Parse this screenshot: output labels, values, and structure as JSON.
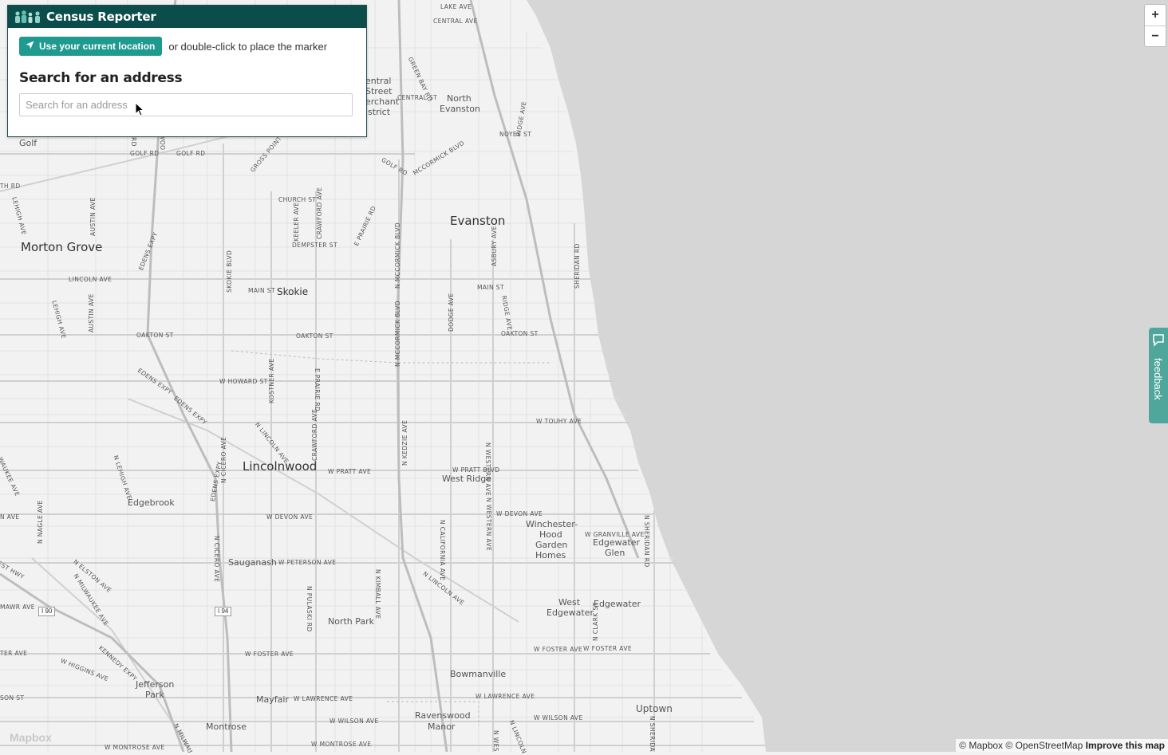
{
  "panel": {
    "title": "Census Reporter",
    "locate_button": "Use your current location",
    "hint": "or double-click to place the marker",
    "search_heading": "Search for an address",
    "search_placeholder": "Search for an address"
  },
  "zoom": {
    "in": "+",
    "out": "−"
  },
  "feedback": {
    "label": "feedback"
  },
  "mapbox_logo": "Mapbox",
  "attribution": {
    "mapbox": "© Mapbox",
    "osm": "© OpenStreetMap",
    "improve": "Improve this map"
  },
  "colors": {
    "panel_header": "#0b4d4a",
    "accent": "#1e9a8f",
    "lake": "#d6d6d6",
    "land": "#f2f2f2",
    "feedback": "#4fa79b"
  },
  "map": {
    "cities": [
      {
        "id": "evanston",
        "text": "Evanston"
      },
      {
        "id": "morton-grove",
        "text": "Morton Grove"
      },
      {
        "id": "lincolnwood",
        "text": "Lincolnwood"
      }
    ],
    "places": [
      {
        "id": "skokie",
        "text": "Skokie"
      },
      {
        "id": "golf",
        "text": "Golf"
      },
      {
        "id": "edgebrook",
        "text": "Edgebrook"
      },
      {
        "id": "sauganash",
        "text": "Sauganash"
      },
      {
        "id": "west-ridge",
        "text": "West Ridge"
      },
      {
        "id": "north-park",
        "text": "North Park"
      },
      {
        "id": "bowmanville",
        "text": "Bowmanville"
      },
      {
        "id": "uptown",
        "text": "Uptown"
      },
      {
        "id": "mayfair",
        "text": "Mayfair"
      },
      {
        "id": "montrose",
        "text": "Montrose"
      },
      {
        "id": "jefferson",
        "text": "Jefferson"
      },
      {
        "id": "jefferson-park",
        "text": "Park"
      },
      {
        "id": "ravenswood",
        "text": "Ravenswood"
      },
      {
        "id": "ravenswood-manor",
        "text": "Manor"
      },
      {
        "id": "north",
        "text": "North"
      },
      {
        "id": "north-evanston",
        "text": "Evanston"
      },
      {
        "id": "winchester",
        "text": "Winchester-"
      },
      {
        "id": "winchester-hood",
        "text": "Hood"
      },
      {
        "id": "garden",
        "text": "Garden"
      },
      {
        "id": "homes",
        "text": "Homes"
      },
      {
        "id": "edgewater",
        "text": "Edgewater"
      },
      {
        "id": "edgewater-glen",
        "text": "Glen"
      },
      {
        "id": "edgewater-2",
        "text": "Edgewater"
      },
      {
        "id": "west",
        "text": "West"
      },
      {
        "id": "west-edgewater",
        "text": "Edgewater"
      },
      {
        "id": "central",
        "text": "entral"
      },
      {
        "id": "street",
        "text": "Street"
      },
      {
        "id": "merchant",
        "text": "erchant"
      },
      {
        "id": "district",
        "text": "istrict"
      }
    ],
    "streets": [
      {
        "id": "lake-ave",
        "text": "LAKE AVE"
      },
      {
        "id": "central-ave",
        "text": "CENTRAL AVE"
      },
      {
        "id": "green-bay-rd",
        "text": "GREEN BAY RD"
      },
      {
        "id": "central-st",
        "text": "CENTRAL ST"
      },
      {
        "id": "noyes-st",
        "text": "NOYES ST"
      },
      {
        "id": "ridge-ave-n",
        "text": "RIDGE AVE"
      },
      {
        "id": "mccormick-blvd",
        "text": "MCCORMICK BLVD"
      },
      {
        "id": "golf-rd-e",
        "text": "GOLF RD"
      },
      {
        "id": "golf-rd-w1",
        "text": "GOLF RD"
      },
      {
        "id": "golf-rd-w2",
        "text": "GOLF RD"
      },
      {
        "id": "gross-point-rd",
        "text": "GROSS POINT RD"
      },
      {
        "id": "church-st",
        "text": "CHURCH ST"
      },
      {
        "id": "crawford-ave",
        "text": "CRAWFORD AVE"
      },
      {
        "id": "keeler-ave",
        "text": "KEELER AVE"
      },
      {
        "id": "dempster-st",
        "text": "DEMPSTER ST"
      },
      {
        "id": "e-prairie-rd",
        "text": "E PRAIRIE RD"
      },
      {
        "id": "n-mccormick-blvd-1",
        "text": "N MCCORMICK BLVD"
      },
      {
        "id": "dodge-ave",
        "text": "DODGE AVE"
      },
      {
        "id": "asbury-ave",
        "text": "ASBURY AVE"
      },
      {
        "id": "sheridan-rd",
        "text": "SHERIDAN RD"
      },
      {
        "id": "main-st-e",
        "text": "MAIN ST"
      },
      {
        "id": "ridge-ave",
        "text": "RIDGE AVE"
      },
      {
        "id": "oakton-st-e",
        "text": "OAKTON ST"
      },
      {
        "id": "main-st-w",
        "text": "MAIN ST"
      },
      {
        "id": "skokie-blvd",
        "text": "SKOKIE BLVD"
      },
      {
        "id": "lincoln-ave",
        "text": "LINCOLN AVE"
      },
      {
        "id": "austin-ave-1",
        "text": "AUSTIN AVE"
      },
      {
        "id": "austin-ave-2",
        "text": "AUSTIN AVE"
      },
      {
        "id": "lehigh-ave-1",
        "text": "LEHIGH AVE"
      },
      {
        "id": "lehigh-ave-2",
        "text": "LEHIGH AVE"
      },
      {
        "id": "edens-expy-1",
        "text": "EDENS EXPY"
      },
      {
        "id": "oakton-st-w",
        "text": "OAKTON ST"
      },
      {
        "id": "oakton-st-m",
        "text": "OAKTON ST"
      },
      {
        "id": "n-mccormick-blvd-2",
        "text": "N MCCORMICK BLVD"
      },
      {
        "id": "w-howard-st",
        "text": "W HOWARD ST"
      },
      {
        "id": "kostner-ave",
        "text": "KOSTNER AVE"
      },
      {
        "id": "e-prairie-rd-2",
        "text": "E PRAIRIE RD"
      },
      {
        "id": "edens-expy-2",
        "text": "EDENS EXPY"
      },
      {
        "id": "edens-expy-3",
        "text": "EDENS EXPY"
      },
      {
        "id": "n-lincoln-ave-1",
        "text": "N LINCOLN AVE"
      },
      {
        "id": "crawford-ave-2",
        "text": "CRAWFORD AVE"
      },
      {
        "id": "n-kedzie-ave",
        "text": "N KEDZIE AVE"
      },
      {
        "id": "w-touhy-ave",
        "text": "W TOUHY AVE"
      },
      {
        "id": "n-western-ave-1",
        "text": "N WESTERN AVE"
      },
      {
        "id": "w-pratt-blvd",
        "text": "W PRATT BLVD"
      },
      {
        "id": "w-pratt-ave",
        "text": "W PRATT AVE"
      },
      {
        "id": "n-cicero-ave-1",
        "text": "N CICERO AVE"
      },
      {
        "id": "n-lehigh-ave",
        "text": "N LEHIGH AVE"
      },
      {
        "id": "w-devon-ave-1",
        "text": "W DEVON AVE"
      },
      {
        "id": "w-devon-ave-2",
        "text": "W DEVON AVE"
      },
      {
        "id": "n-western-ave-2",
        "text": "N WESTERN AVE"
      },
      {
        "id": "n-california-ave",
        "text": "N CALIFORNIA AVE"
      },
      {
        "id": "w-granville-ave",
        "text": "W GRANVILLE AVE"
      },
      {
        "id": "n-sheridan-rd",
        "text": "N SHERIDAN RD"
      },
      {
        "id": "edens-expy-4",
        "text": "EDENS EXPY"
      },
      {
        "id": "n-cicero-ave-2",
        "text": "N CICERO AVE"
      },
      {
        "id": "w-peterson-ave",
        "text": "W PETERSON AVE"
      },
      {
        "id": "n-nagle-ave",
        "text": "N NAGLE AVE"
      },
      {
        "id": "n-elston-ave",
        "text": "N ELSTON AVE"
      },
      {
        "id": "n-milwaukee-ave",
        "text": "N MILWAUKEE AVE"
      },
      {
        "id": "n-kimball-ave",
        "text": "N KIMBALL AVE"
      },
      {
        "id": "n-lincoln-ave-2",
        "text": "N LINCOLN AVE"
      },
      {
        "id": "n-pulaski-rd",
        "text": "N PULASKI RD"
      },
      {
        "id": "n-clark-st",
        "text": "N CLARK ST"
      },
      {
        "id": "w-foster-ave-1",
        "text": "W FOSTER AVE"
      },
      {
        "id": "w-foster-ave-2",
        "text": "W FOSTER AVE"
      },
      {
        "id": "w-foster-ave-3",
        "text": "W FOSTER AVE"
      },
      {
        "id": "kennedy-expy",
        "text": "KENNEDY EXPY"
      },
      {
        "id": "w-higgins-ave",
        "text": "W HIGGINS AVE"
      },
      {
        "id": "w-lawrence-ave-1",
        "text": "W LAWRENCE AVE"
      },
      {
        "id": "w-lawrence-ave-2",
        "text": "W LAWRENCE AVE"
      },
      {
        "id": "w-wilson-ave-1",
        "text": "W WILSON AVE"
      },
      {
        "id": "w-wilson-ave-2",
        "text": "W WILSON AVE"
      },
      {
        "id": "w-montrose-ave-1",
        "text": "W MONTROSE AVE"
      },
      {
        "id": "w-montrose-ave-2",
        "text": "W MONTROSE AVE"
      },
      {
        "id": "n-milwaukee-2",
        "text": "N MILWAU"
      },
      {
        "id": "n-lincoln-3",
        "text": "N LINCOLN"
      },
      {
        "id": "n-sherida",
        "text": "N SHERIDA"
      },
      {
        "id": "n-wes",
        "text": "N WES"
      },
      {
        "id": "edge-ave-1",
        "text": "TH RD"
      },
      {
        "id": "edge-ave-2",
        "text": "N AVE"
      },
      {
        "id": "edge-ave-3",
        "text": "MAWR AVE"
      },
      {
        "id": "edge-ave-4",
        "text": "TER AVE"
      },
      {
        "id": "edge-ave-5",
        "text": "SON ST"
      },
      {
        "id": "edge-ave-6",
        "text": "EST HWY"
      },
      {
        "id": "edge-ave-7",
        "text": "WAUKEE AVE"
      },
      {
        "id": "golf-rd-v",
        "text": "RD"
      },
      {
        "id": "woo",
        "text": "WOO"
      }
    ],
    "highways": [
      {
        "id": "i90",
        "text": "I 90"
      },
      {
        "id": "i94",
        "text": "I 94"
      }
    ]
  }
}
